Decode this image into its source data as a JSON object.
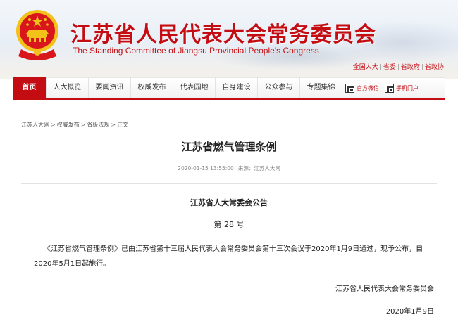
{
  "header": {
    "title": "江苏省人民代表大会常务委员会",
    "subtitle": "The Standing Committee of Jiangsu Provincial People's Congress",
    "top_links": [
      "全国人大",
      "省委",
      "省政府",
      "省政协"
    ]
  },
  "nav": {
    "items": [
      "首页",
      "人大概览",
      "要闻资讯",
      "权威发布",
      "代表园地",
      "自身建设",
      "公众参与",
      "专题集锦"
    ],
    "active_index": 0,
    "wechat_label": "官方微信",
    "mobile_label": "手机门户"
  },
  "breadcrumb": [
    "江苏人大网",
    "权威发布",
    "省级法规",
    "正文"
  ],
  "article": {
    "title": "江苏省燃气管理条例",
    "datetime": "2020-01-15 13:55:00",
    "source": "来源：江苏人大网",
    "notice_title": "江苏省人大常委会公告",
    "notice_number": "第 28 号",
    "body": "《江苏省燃气管理条例》已由江苏省第十三届人民代表大会常务委员会第十三次会议于2020年1月9日通过，现予公布，自2020年5月1日起施行。",
    "signer": "江苏省人民代表大会常务委员会",
    "sign_date": "2020年1月9日"
  },
  "colors": {
    "brand_red": "#c40d12",
    "emblem_gold": "#f2c11a"
  },
  "icons": [
    "national-emblem-icon",
    "qr-code-icon"
  ]
}
